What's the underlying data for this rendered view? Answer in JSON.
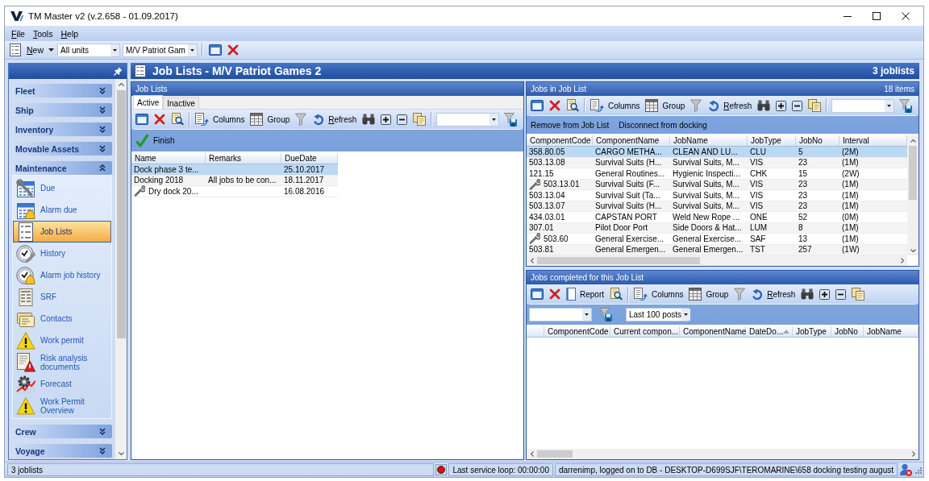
{
  "window": {
    "title": "TM Master v2 (v.2.658 - 01.09.2017)"
  },
  "menu": [
    "File",
    "Tools",
    "Help"
  ],
  "toolbar": {
    "new_button": "New",
    "unit_filter": "All units",
    "vessel_filter": "M/V Patriot Gam"
  },
  "sidebar": {
    "groups": [
      {
        "label": "Fleet",
        "expanded": false
      },
      {
        "label": "Ship",
        "expanded": false
      },
      {
        "label": "Inventory",
        "expanded": false
      },
      {
        "label": "Movable Assets",
        "expanded": false
      },
      {
        "label": "Maintenance",
        "expanded": true,
        "items": [
          {
            "label": "Due",
            "kind": "due",
            "selected": false
          },
          {
            "label": "Alarm due",
            "kind": "alarm-due",
            "selected": false
          },
          {
            "label": "Job Lists",
            "kind": "job-lists",
            "selected": true
          },
          {
            "label": "History",
            "kind": "history",
            "selected": false
          },
          {
            "label": "Alarm job history",
            "kind": "alarm-history",
            "selected": false
          },
          {
            "label": "SRF",
            "kind": "srf",
            "selected": false
          },
          {
            "label": "Contacts",
            "kind": "contacts",
            "selected": false
          },
          {
            "label": "Work permit",
            "kind": "permit",
            "selected": false
          },
          {
            "label": "Risk analysis documents",
            "kind": "risk",
            "selected": false
          },
          {
            "label": "Forecast",
            "kind": "forecast",
            "selected": false
          },
          {
            "label": "Work Permit Overview",
            "kind": "permit",
            "selected": false
          }
        ]
      },
      {
        "label": "Crew",
        "expanded": false
      },
      {
        "label": "Voyage",
        "expanded": false
      }
    ]
  },
  "page_header": {
    "title": "Job Lists - M/V Patriot Games 2",
    "count": "3 joblists"
  },
  "job_lists": {
    "title": "Job Lists",
    "tabs": [
      {
        "label": "Active",
        "selected": true
      },
      {
        "label": "Inactive",
        "selected": false
      }
    ],
    "toolbar": {
      "columns": "Columns",
      "group": "Group",
      "refresh": "Refresh"
    },
    "actions": [
      {
        "label": "Finish",
        "kind": "confirm"
      }
    ],
    "table": {
      "columns": [
        {
          "label": "Name",
          "sorted": false
        },
        {
          "label": "Remarks",
          "sorted": false
        },
        {
          "label": "DueDate",
          "sorted": false
        }
      ],
      "rows": [
        {
          "name": "Dock phase 3 te...",
          "due_date": "25.10.2017",
          "kind": "plain",
          "selected": true
        },
        {
          "name": "Docking 2018",
          "remarks": "All jobs to be con...",
          "due_date": "18.11.2017",
          "kind": "plain",
          "selected": false
        },
        {
          "name": "Dry dock 20...",
          "due_date": "16.08.2016",
          "kind": "tool",
          "selected": false
        }
      ]
    }
  },
  "jobs_in_list": {
    "title": "Jobs in Job List",
    "count": "18 items",
    "toolbar": {
      "columns": "Columns",
      "group": "Group",
      "refresh": "Refresh"
    },
    "actions": [
      {
        "label": "Remove from Job List",
        "kind": "plain"
      },
      {
        "label": "Disconnect from docking",
        "kind": "plain"
      }
    ],
    "table": {
      "columns": [
        {
          "label": "ComponentCode",
          "sorted": false
        },
        {
          "label": "ComponentName",
          "sorted": false
        },
        {
          "label": "JobName",
          "sorted": false
        },
        {
          "label": "JobType",
          "sorted": false
        },
        {
          "label": "JobNo",
          "sorted": false
        },
        {
          "label": "Interval",
          "sorted": false
        }
      ],
      "rows": [
        {
          "component_code": "358.80.05",
          "component_name": "CARGO METHA...",
          "job_name": "CLEAN AND LU...",
          "job_type": "CLU",
          "job_no": "5",
          "interval": "(2M)",
          "kind": "plain",
          "selected": true
        },
        {
          "component_code": "503.13.08",
          "component_name": "Survival Suits (H...",
          "job_name": "Survival Suits, M...",
          "job_type": "VIS",
          "job_no": "23",
          "interval": "(1M)",
          "kind": "plain",
          "selected": false
        },
        {
          "component_code": "121.15",
          "component_name": "General Routines...",
          "job_name": "Hygienic Inspecti...",
          "job_type": "CHK",
          "job_no": "15",
          "interval": "(2W)",
          "kind": "plain",
          "selected": false
        },
        {
          "component_code": "503.13.01",
          "component_name": "Survival Suits (F...",
          "job_name": "Survival Suits, M...",
          "job_type": "VIS",
          "job_no": "23",
          "interval": "(1M)",
          "kind": "tool",
          "selected": false
        },
        {
          "component_code": "503.13.04",
          "component_name": "Survival Suit (Ta...",
          "job_name": "Survival Suits, M...",
          "job_type": "VIS",
          "job_no": "23",
          "interval": "(1M)",
          "kind": "plain",
          "selected": false
        },
        {
          "component_code": "503.13.07",
          "component_name": "Survival Suits (H...",
          "job_name": "Survival Suits, M...",
          "job_type": "VIS",
          "job_no": "23",
          "interval": "(1M)",
          "kind": "plain",
          "selected": false
        },
        {
          "component_code": "434.03.01",
          "component_name": "CAPSTAN PORT",
          "job_name": "Weld New Rope ...",
          "job_type": "ONE",
          "job_no": "52",
          "interval": "(0M)",
          "kind": "plain",
          "selected": false
        },
        {
          "component_code": "307.01",
          "component_name": "Pilot Door Port",
          "job_name": "Side Doors & Hat...",
          "job_type": "LUM",
          "job_no": "8",
          "interval": "(1M)",
          "kind": "plain",
          "selected": false
        },
        {
          "component_code": "503.60",
          "component_name": "General Exercise...",
          "job_name": "General Exercise...",
          "job_type": "SAF",
          "job_no": "13",
          "interval": "(1M)",
          "kind": "tool",
          "selected": false
        },
        {
          "component_code": "503.81",
          "component_name": "General Emergen...",
          "job_name": "General Emergen...",
          "job_type": "TST",
          "job_no": "257",
          "interval": "(1W)",
          "kind": "plain",
          "selected": false
        }
      ]
    }
  },
  "completed_jobs": {
    "title": "Jobs completed for this Job List",
    "toolbar": {
      "report": "Report",
      "columns": "Columns",
      "group": "Group",
      "refresh": "Refresh"
    },
    "period_filter": "Last 100 posts",
    "table": {
      "indicator_column": true,
      "columns": [
        {
          "label": "ComponentCode",
          "sorted": false
        },
        {
          "label": "Current compon...",
          "sorted": false
        },
        {
          "label": "ComponentName",
          "sorted": false
        },
        {
          "label": "DateDo...",
          "sorted": true
        },
        {
          "label": "JobType",
          "sorted": false
        },
        {
          "label": "JobNo",
          "sorted": false
        },
        {
          "label": "JobName",
          "sorted": false
        }
      ]
    }
  },
  "status_bar": {
    "message": "3 joblists",
    "service_loop": "Last service loop: 00:00:00",
    "connection": "darrenimp, logged on to DB - DESKTOP-D699SJF\\TEROMARINE\\658 docking testing august"
  }
}
